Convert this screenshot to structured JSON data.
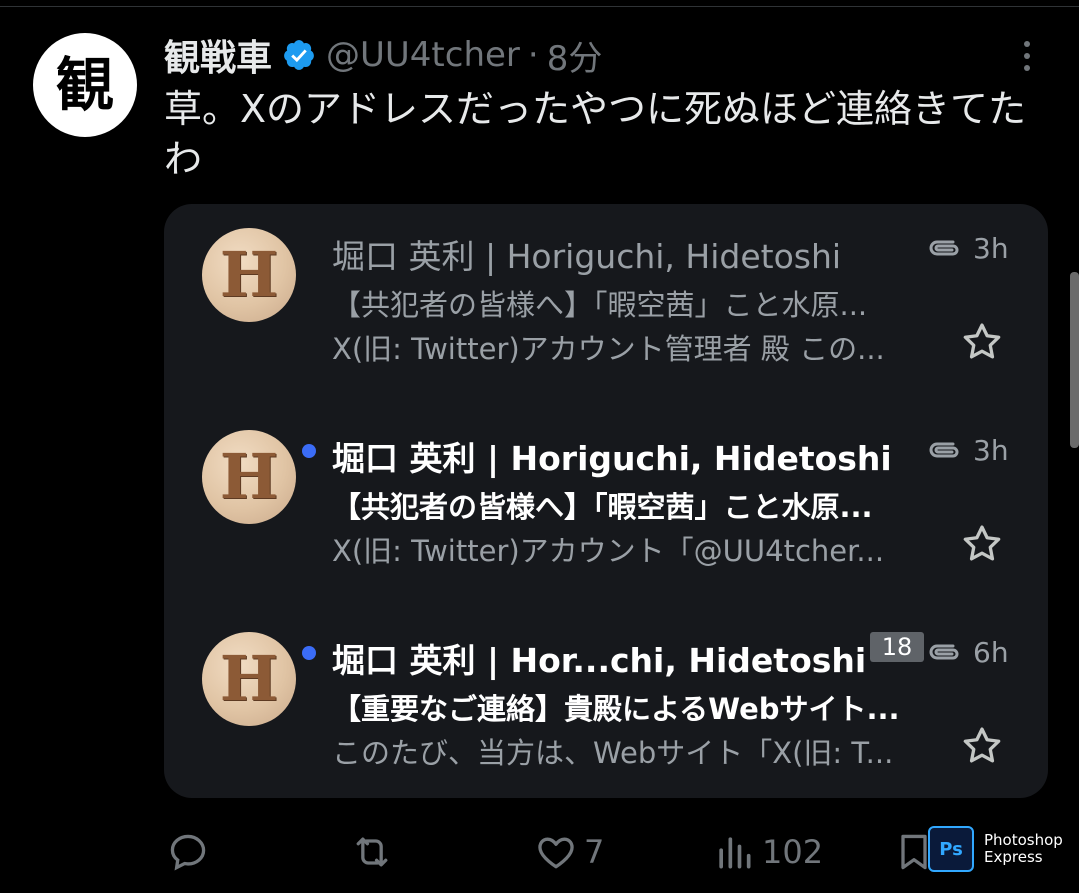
{
  "tweet": {
    "avatar_char": "観",
    "name": "観戦車",
    "handle": "@UU4tcher",
    "separator": "·",
    "time": "8分",
    "text": "草。Xのアドレスだったやつに死ぬほど連絡きてたわ",
    "verified_color": "#1d9bf0"
  },
  "emails": [
    {
      "avatar_letter": "H",
      "from": "堀口 英利 | Horiguchi, Hidetoshi",
      "subject": "【共犯者の皆様へ】「暇空茜」こと水原...",
      "preview": "X(旧: Twitter)アカウント管理者 殿 この...",
      "time": "3h",
      "unread": false
    },
    {
      "avatar_letter": "H",
      "from": "堀口 英利 | Horiguchi, Hidetoshi",
      "subject": "【共犯者の皆様へ】「暇空茜」こと水原...",
      "preview": "X(旧: Twitter)アカウント「@UU4tcher...",
      "time": "3h",
      "unread": true
    },
    {
      "avatar_letter": "H",
      "from": "堀口 英利 | Hor...chi, Hidetoshi",
      "subject": "【重要なご連絡】貴殿によるWebサイト...",
      "preview": "このたび、当方は、Webサイト「X(旧: T...",
      "time": "6h",
      "unread": true,
      "count": "18"
    }
  ],
  "actions": {
    "reply": "",
    "retweet": "",
    "likes": "7",
    "views": "102"
  },
  "watermark": {
    "logo": "Ps",
    "line1": "Photoshop",
    "line2": "Express"
  },
  "colors": {
    "background": "#000000",
    "card": "#16181c",
    "unread_dot": "#3b6cf6",
    "muted": "#71767b"
  }
}
